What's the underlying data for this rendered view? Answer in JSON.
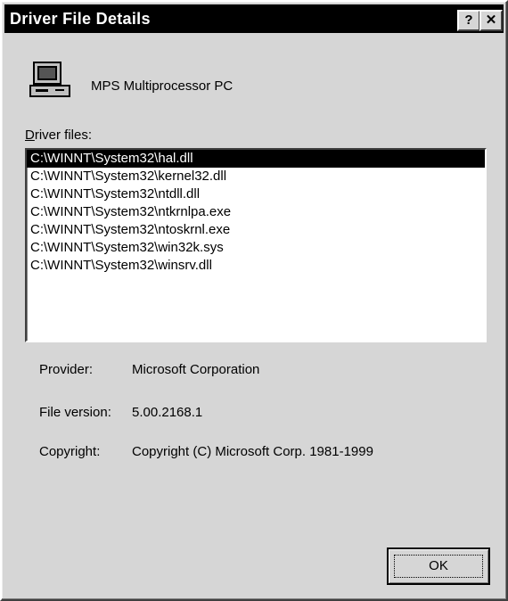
{
  "window": {
    "title": "Driver File Details",
    "help_button": "?",
    "close_button": "✕"
  },
  "device": {
    "icon": "computer-icon",
    "name": "MPS Multiprocessor PC"
  },
  "driver_files": {
    "label_access": "D",
    "label_rest": "river files:",
    "selected_index": 0,
    "items": [
      "C:\\WINNT\\System32\\hal.dll",
      "C:\\WINNT\\System32\\kernel32.dll",
      "C:\\WINNT\\System32\\ntdll.dll",
      "C:\\WINNT\\System32\\ntkrnlpa.exe",
      "C:\\WINNT\\System32\\ntoskrnl.exe",
      "C:\\WINNT\\System32\\win32k.sys",
      "C:\\WINNT\\System32\\winsrv.dll"
    ]
  },
  "properties": {
    "provider_label": "Provider:",
    "provider_value": "Microsoft Corporation",
    "version_label": "File version:",
    "version_value": "5.00.2168.1",
    "copyright_label": "Copyright:",
    "copyright_value": "Copyright (C) Microsoft Corp. 1981-1999"
  },
  "buttons": {
    "ok": "OK"
  }
}
